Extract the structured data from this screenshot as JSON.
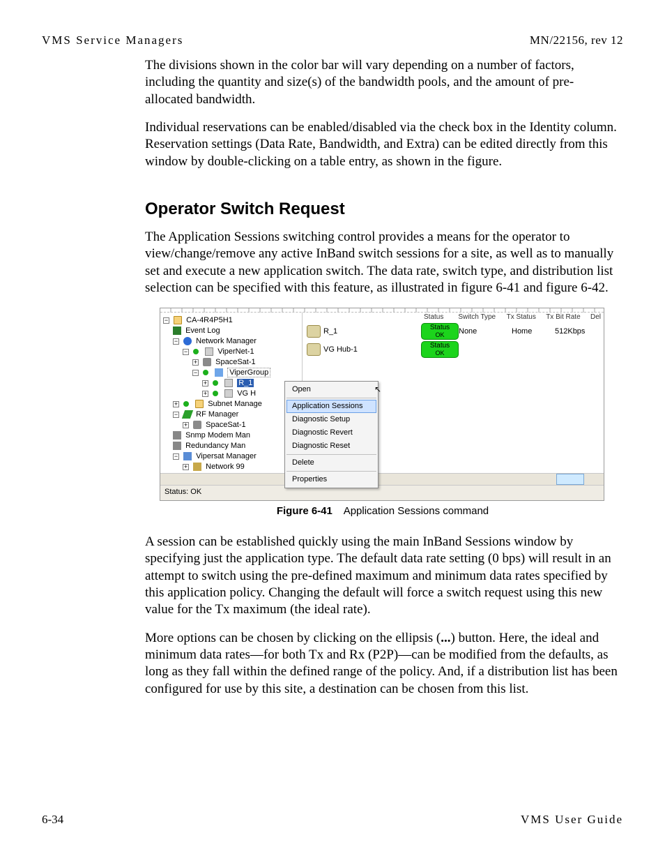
{
  "header": {
    "left": "VMS Service Managers",
    "right": "MN/22156, rev 12"
  },
  "intro_paras": [
    "The divisions shown in the color bar will vary depending on a number of factors, including the quantity and size(s) of the bandwidth pools, and the amount of pre-allocated bandwidth.",
    "Individual reservations can be enabled/disabled via the check box in the Identity column. Reservation settings (Data Rate, Bandwidth, and Extra) can be edited directly from this window by double-clicking on a table entry, as shown in the figure."
  ],
  "section_heading": "Operator Switch Request",
  "section_paras": [
    "The Application Sessions switching control provides a means for the operator to view/change/remove any active InBand switch sessions for a site, as well as to manually set and execute a new application switch. The data rate, switch type, and distribution list selection can be specified with this feature, as illustrated in figure 6-41 and figure 6-42."
  ],
  "figure": {
    "number": "Figure 6-41",
    "caption": "Application Sessions command",
    "tree": {
      "root": "CA-4R4P5H1",
      "event_log": "Event Log",
      "network_mgr": "Network Manager",
      "vipernet": "ViperNet-1",
      "spacesat_a": "SpaceSat-1",
      "vipergroup": "ViperGroup",
      "r1": "R_1",
      "vgh": "VG H",
      "subnet_mgr": "Subnet Manage",
      "rf_mgr": "RF Manager",
      "spacesat_b": "SpaceSat-1",
      "snmp": "Snmp Modem Man",
      "redund": "Redundancy Man",
      "vipersat_mgr": "Vipersat Manager",
      "network99": "Network 99"
    },
    "context_menu": {
      "open": "Open",
      "app_sessions": "Application Sessions",
      "diag_setup": "Diagnostic Setup",
      "diag_revert": "Diagnostic Revert",
      "diag_reset": "Diagnostic Reset",
      "delete": "Delete",
      "properties": "Properties"
    },
    "list_headers": {
      "status": "Status",
      "switch_type": "Switch Type",
      "tx_status": "Tx Status",
      "tx_bitrate": "Tx Bit Rate",
      "del": "Del"
    },
    "rows": [
      {
        "name": "R_1",
        "status_top": "Status",
        "status_bottom": "OK",
        "switch_type": "None",
        "tx_status": "Home",
        "tx_bitrate": "512Kbps"
      },
      {
        "name": "VG Hub-1",
        "status_top": "Status",
        "status_bottom": "OK",
        "switch_type": "",
        "tx_status": "",
        "tx_bitrate": ""
      }
    ],
    "status_bar": "Status: OK"
  },
  "after_figure_paras": [
    "A session can be established quickly using the main InBand Sessions window by specifying just the application type. The default data rate setting (0 bps) will result in an attempt to switch using the pre-defined maximum and minimum data rates specified by this application policy. Changing the default will force a switch request using this new value for the Tx maximum (the ideal rate)."
  ],
  "more_options_para": {
    "pre": "More options can be chosen by clicking on the ellipsis (",
    "ellipsis": "...",
    "post": ") button. Here, the ideal and minimum data rates—for both Tx and Rx (P2P)—can be modified from the defaults, as long as they fall within the defined range of the policy. And, if a distribution list has been configured for use by this site, a destination can be chosen from this list."
  },
  "footer": {
    "left": "6-34",
    "right": "VMS User Guide"
  }
}
